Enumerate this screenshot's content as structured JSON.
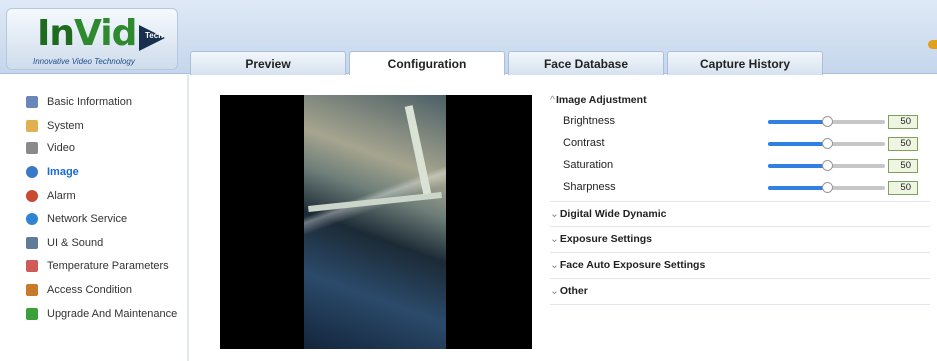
{
  "logo": {
    "name_part1": "In",
    "name_part2": "Vid",
    "badge": "Tech",
    "tagline": "Innovative Video Technology"
  },
  "tabs": [
    {
      "label": "Preview",
      "active": false
    },
    {
      "label": "Configuration",
      "active": true
    },
    {
      "label": "Face Database",
      "active": false
    },
    {
      "label": "Capture History",
      "active": false
    }
  ],
  "menu": [
    {
      "label": "Basic Information",
      "icon": "document-icon",
      "color": "#6a86b8",
      "active": false
    },
    {
      "label": "System",
      "icon": "system-icon",
      "color": "#e0b050",
      "active": false
    },
    {
      "label": "Video",
      "icon": "video-icon",
      "color": "#8a8a8a",
      "active": false
    },
    {
      "label": "Image",
      "icon": "image-icon",
      "color": "#3a78c8",
      "active": true
    },
    {
      "label": "Alarm",
      "icon": "alarm-icon",
      "color": "#c84a30",
      "active": false
    },
    {
      "label": "Network Service",
      "icon": "network-icon",
      "color": "#2e84d0",
      "active": false
    },
    {
      "label": "UI & Sound",
      "icon": "sound-icon",
      "color": "#607a9a",
      "active": false
    },
    {
      "label": "Temperature Parameters",
      "icon": "temperature-icon",
      "color": "#d05a5a",
      "active": false
    },
    {
      "label": "Access Condition",
      "icon": "access-icon",
      "color": "#c87a2a",
      "active": false
    },
    {
      "label": "Upgrade And Maintenance",
      "icon": "upgrade-icon",
      "color": "#3aa03a",
      "active": false
    }
  ],
  "panel": {
    "image_adjustment": {
      "title": "Image Adjustment",
      "rows": [
        {
          "label": "Brightness",
          "value": "50",
          "level": 0.5
        },
        {
          "label": "Contrast",
          "value": "50",
          "level": 0.5
        },
        {
          "label": "Saturation",
          "value": "50",
          "level": 0.5
        },
        {
          "label": "Sharpness",
          "value": "50",
          "level": 0.5
        }
      ]
    },
    "sections": [
      {
        "title": "Digital Wide Dynamic"
      },
      {
        "title": "Exposure Settings"
      },
      {
        "title": "Face Auto Exposure Settings"
      },
      {
        "title": "Other"
      }
    ]
  },
  "colors": {
    "accent": "#2f80e0",
    "active_menu": "#1a6ad4",
    "value_border": "#7ea05a"
  }
}
